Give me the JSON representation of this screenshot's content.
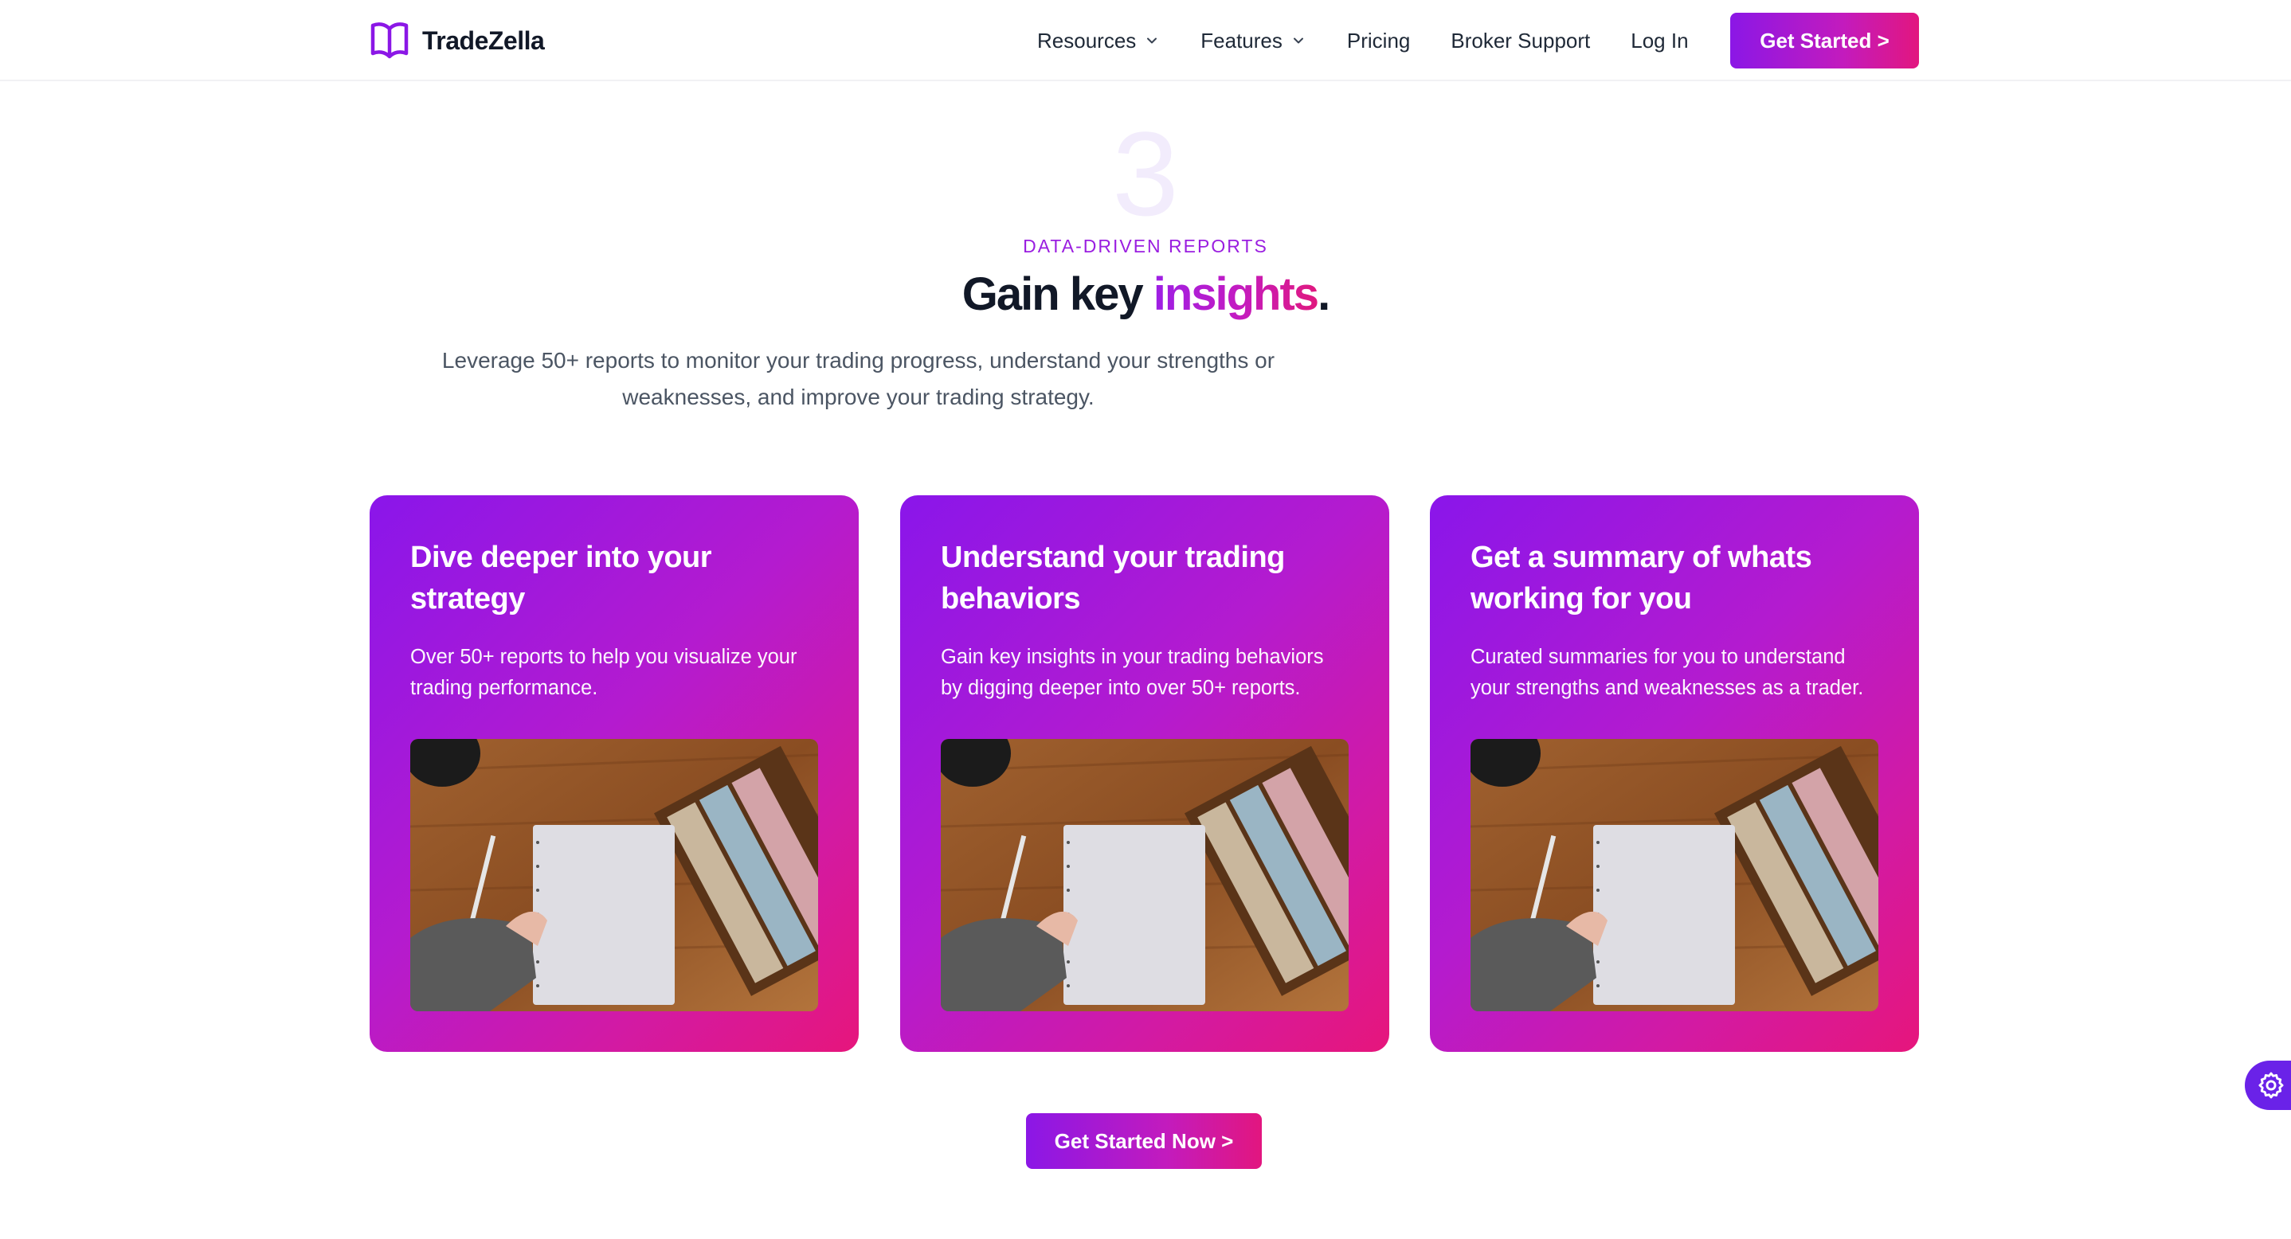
{
  "brand": {
    "name": "TradeZella",
    "accent": "#8b17e6",
    "accent_end": "#e2167f"
  },
  "nav": {
    "items": [
      {
        "label": "Resources",
        "has_dropdown": true
      },
      {
        "label": "Features",
        "has_dropdown": true
      },
      {
        "label": "Pricing",
        "has_dropdown": false
      },
      {
        "label": "Broker Support",
        "has_dropdown": false
      },
      {
        "label": "Log In",
        "has_dropdown": false
      }
    ],
    "cta_label": "Get Started >"
  },
  "hero": {
    "step_number": "3",
    "eyebrow": "DATA-DRIVEN REPORTS",
    "headline_plain": "Gain key ",
    "headline_accent": "insights",
    "headline_end": ".",
    "lead": "Leverage 50+ reports to monitor your trading progress, understand your strengths or weaknesses, and improve your trading strategy."
  },
  "cards": [
    {
      "title": "Dive deeper into your strategy",
      "description": "Over 50+ reports to help you visualize your trading performance.",
      "image_alt": "notebook-on-desk-photo"
    },
    {
      "title": "Understand your trading behaviors",
      "description": "Gain key insights in your trading behaviors by digging deeper into over 50+ reports.",
      "image_alt": "notebook-on-desk-photo"
    },
    {
      "title": "Get a summary of whats working for you",
      "description": "Curated summaries for you to understand your strengths and weaknesses as a trader.",
      "image_alt": "notebook-on-desk-photo"
    }
  ],
  "cta": {
    "label": "Get Started Now >"
  },
  "widgets": {
    "settings_icon": "gear-icon"
  }
}
